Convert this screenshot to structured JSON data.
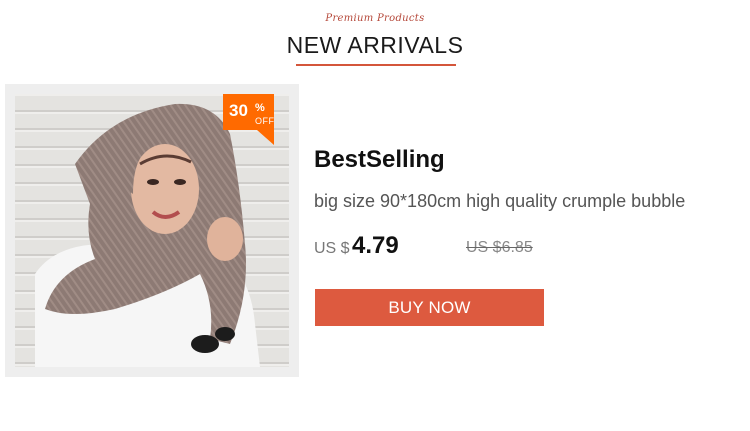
{
  "header": {
    "subtitle": "Premium Products",
    "title": "NEW ARRIVALS"
  },
  "product": {
    "image_icon": "woman-in-crumple-hijab-photo",
    "badge": {
      "number": "30",
      "percent": "%",
      "off": "OFF"
    },
    "name": "BestSelling",
    "description": "big size 90*180cm high quality crumple bubble",
    "price": {
      "currency": "US $",
      "value": "4.79"
    },
    "original_price": "US $6.85",
    "button_label": "BUY NOW"
  },
  "colors": {
    "accent": "#dd5a3f",
    "badge": "#ff6a00",
    "subtitle": "#b5483a"
  }
}
